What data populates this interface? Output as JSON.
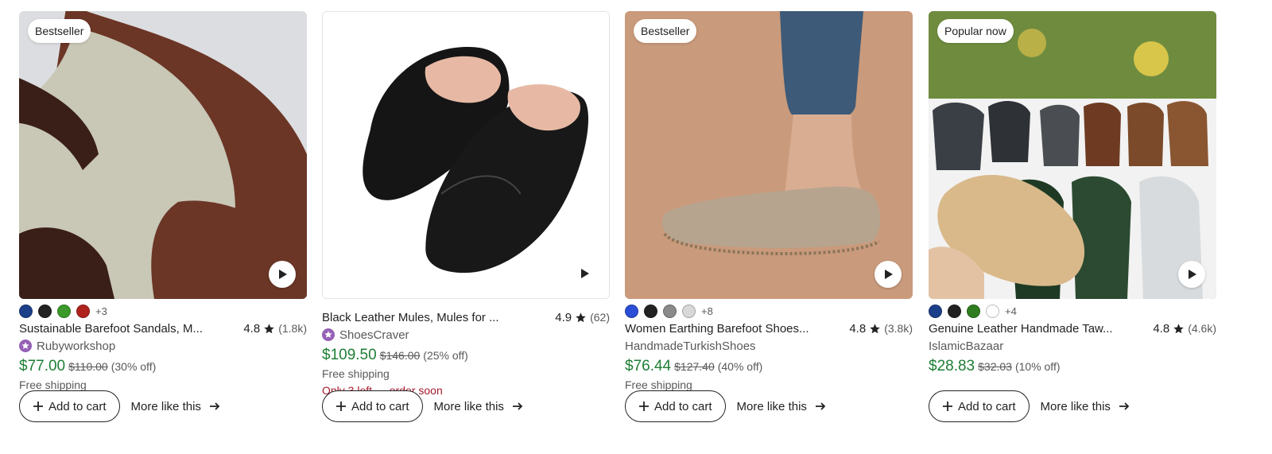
{
  "listings": [
    {
      "badge": "Bestseller",
      "swatches": [
        "#1c3f8a",
        "#222222",
        "#3b9a2b",
        "#b0221e"
      ],
      "swatches_more": "+3",
      "title": "Sustainable Barefoot Sandals, M...",
      "rating": "4.8",
      "review_count": "(1.8k)",
      "shop": "Rubyworkshop",
      "star_seller": true,
      "price": "$77.00",
      "original_price": "$110.00",
      "discount": "(30% off)",
      "shipping": "Free shipping",
      "stock_note": "",
      "cart_label": "Add to cart",
      "more_label": "More like this"
    },
    {
      "badge": "",
      "swatches": [],
      "swatches_more": "",
      "title": "Black Leather Mules, Mules for ...",
      "rating": "4.9",
      "review_count": "(62)",
      "shop": "ShoesCraver",
      "star_seller": true,
      "price": "$109.50",
      "original_price": "$146.00",
      "discount": "(25% off)",
      "shipping": "Free shipping",
      "stock_note": "Only 3 left — order soon",
      "cart_label": "Add to cart",
      "more_label": "More like this"
    },
    {
      "badge": "Bestseller",
      "swatches": [
        "#2a4fd6",
        "#222222",
        "#8a8a8a",
        "#d9d9d9"
      ],
      "swatches_more": "+8",
      "title": "Women Earthing Barefoot Shoes...",
      "rating": "4.8",
      "review_count": "(3.8k)",
      "shop": "HandmadeTurkishShoes",
      "star_seller": false,
      "price": "$76.44",
      "original_price": "$127.40",
      "discount": "(40% off)",
      "shipping": "Free shipping",
      "stock_note": "",
      "cart_label": "Add to cart",
      "more_label": "More like this"
    },
    {
      "badge": "Popular now",
      "swatches": [
        "#1c3f8a",
        "#222222",
        "#2f7d1f",
        "#ffffff"
      ],
      "swatches_more": "+4",
      "title": "Genuine Leather Handmade Taw...",
      "rating": "4.8",
      "review_count": "(4.6k)",
      "shop": "IslamicBazaar",
      "star_seller": false,
      "price": "$28.83",
      "original_price": "$32.03",
      "discount": "(10% off)",
      "shipping": "",
      "stock_note": "",
      "cart_label": "Add to cart",
      "more_label": "More like this"
    }
  ],
  "colors": {
    "sale_price": "#1e7e34",
    "stock_warning": "#a61a2e",
    "star_seller": "#9560b5"
  }
}
